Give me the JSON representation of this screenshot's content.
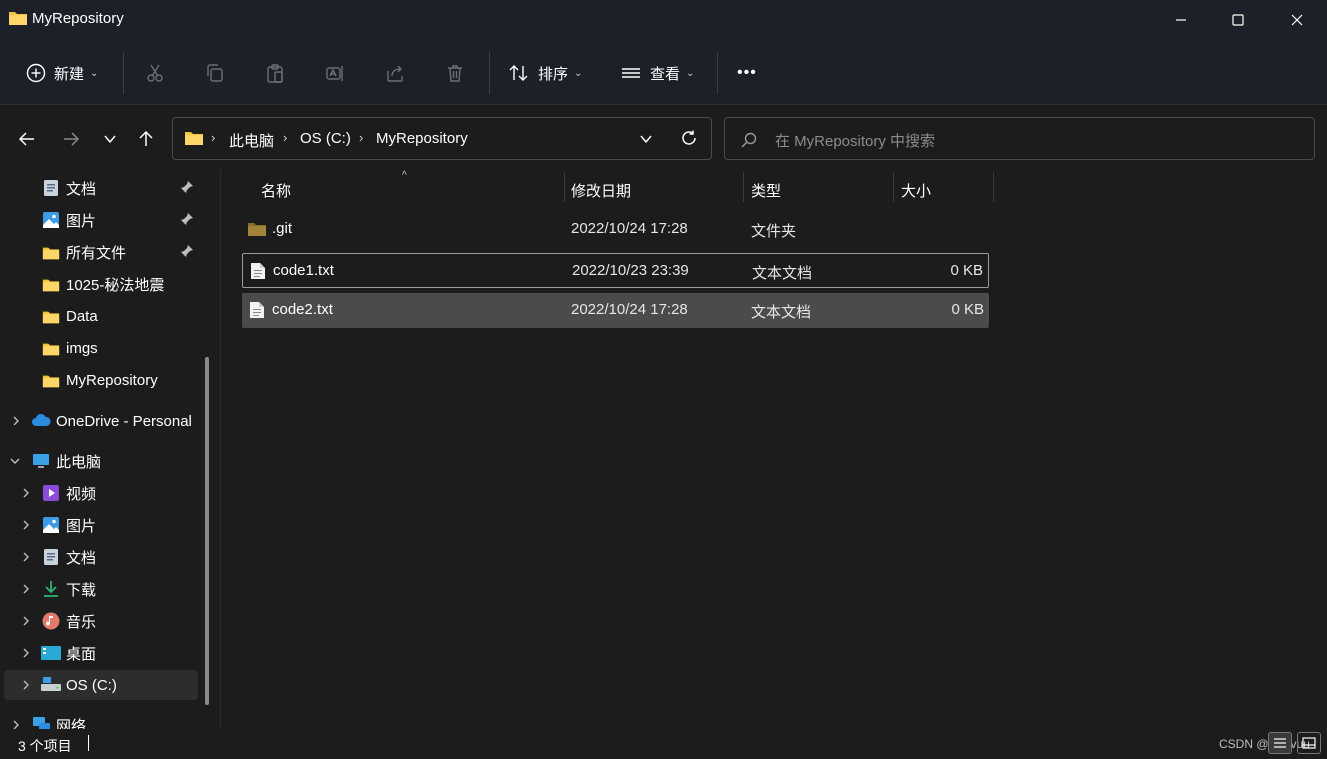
{
  "window": {
    "title": "MyRepository",
    "controls": [
      "minimize",
      "maximize",
      "close"
    ]
  },
  "toolbar": {
    "new_label": "新建",
    "sort_label": "排序",
    "view_label": "查看",
    "more_label": "•••",
    "icons": [
      "plus-circle-icon",
      "cut-icon",
      "copy-icon",
      "paste-icon",
      "rename-icon",
      "share-icon",
      "delete-icon",
      "sort-icon",
      "view-icon",
      "more-icon"
    ]
  },
  "nav": {
    "breadcrumb": [
      "此电脑",
      "OS (C:)",
      "MyRepository"
    ],
    "search_placeholder": "在 MyRepository 中搜索"
  },
  "sidebar": {
    "quick_access": [
      {
        "label": "文档",
        "icon": "document-icon",
        "pinned": true
      },
      {
        "label": "图片",
        "icon": "pictures-icon",
        "pinned": true
      },
      {
        "label": "所有文件",
        "icon": "folder-icon",
        "pinned": true
      },
      {
        "label": "1025-秘法地震",
        "icon": "folder-icon",
        "pinned": false
      },
      {
        "label": "Data",
        "icon": "folder-icon",
        "pinned": false
      },
      {
        "label": "imgs",
        "icon": "folder-icon",
        "pinned": false
      },
      {
        "label": "MyRepository",
        "icon": "folder-icon",
        "pinned": false
      }
    ],
    "onedrive": "OneDrive - Personal",
    "this_pc": "此电脑",
    "pc_children": [
      {
        "label": "视频",
        "icon": "video-icon"
      },
      {
        "label": "图片",
        "icon": "pictures-icon"
      },
      {
        "label": "文档",
        "icon": "document-icon"
      },
      {
        "label": "下载",
        "icon": "download-icon"
      },
      {
        "label": "音乐",
        "icon": "music-icon"
      },
      {
        "label": "桌面",
        "icon": "desktop-icon"
      },
      {
        "label": "OS (C:)",
        "icon": "drive-icon"
      }
    ],
    "network": "网络"
  },
  "columns": {
    "name": "名称",
    "date": "修改日期",
    "type": "类型",
    "size": "大小"
  },
  "files": [
    {
      "name": ".git",
      "date": "2022/10/24 17:28",
      "type": "文件夹",
      "size": ""
    },
    {
      "name": "code1.txt",
      "date": "2022/10/23 23:39",
      "type": "文本文档",
      "size": "0 KB"
    },
    {
      "name": "code2.txt",
      "date": "2022/10/24 17:28",
      "type": "文本文档",
      "size": "0 KB"
    }
  ],
  "status": {
    "count": "3 个项目",
    "watermark": "CSDN @ssc-vuu"
  },
  "colors": {
    "folder": "#f5c342",
    "titlebar_bg": "#1c2029",
    "content_bg": "#1c1c1c",
    "selected_row": "#4b4b4b"
  }
}
